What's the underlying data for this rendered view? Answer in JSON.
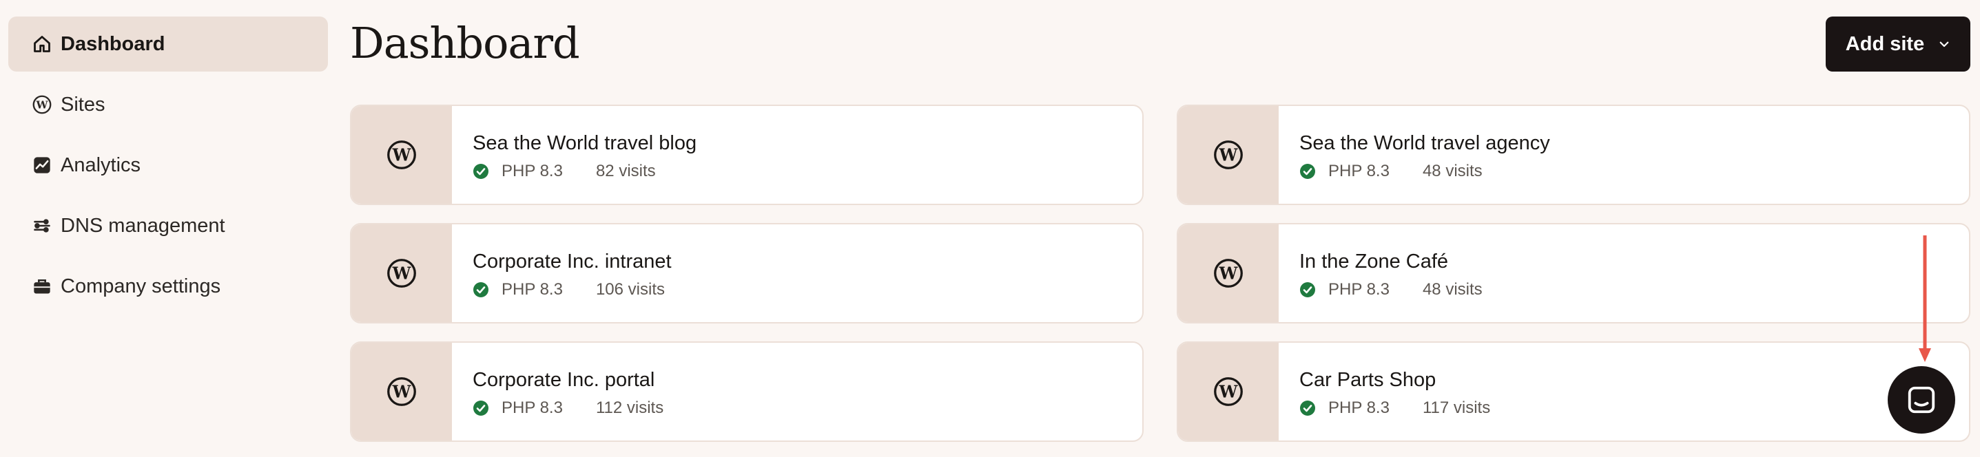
{
  "sidebar": {
    "items": [
      {
        "label": "Dashboard",
        "icon": "home-icon",
        "active": true
      },
      {
        "label": "Sites",
        "icon": "wordpress-icon"
      },
      {
        "label": "Analytics",
        "icon": "analytics-icon"
      },
      {
        "label": "DNS management",
        "icon": "dns-icon"
      },
      {
        "label": "Company settings",
        "icon": "briefcase-icon"
      }
    ]
  },
  "header": {
    "title": "Dashboard",
    "add_site_label": "Add site"
  },
  "sites": [
    {
      "name": "Sea the World travel blog",
      "php": "PHP 8.3",
      "visits": "82 visits"
    },
    {
      "name": "Sea the World travel agency",
      "php": "PHP 8.3",
      "visits": "48 visits"
    },
    {
      "name": "Corporate Inc. intranet",
      "php": "PHP 8.3",
      "visits": "106 visits"
    },
    {
      "name": "In the Zone Café",
      "php": "PHP 8.3",
      "visits": "48 visits"
    },
    {
      "name": "Corporate Inc. portal",
      "php": "PHP 8.3",
      "visits": "112 visits"
    },
    {
      "name": "Car Parts Shop",
      "php": "PHP 8.3",
      "visits": "117 visits"
    }
  ],
  "colors": {
    "background": "#fbf6f3",
    "accent_bg": "#ecdfd7",
    "thumb_bg": "#ebdcd3",
    "button_dark": "#1a1414",
    "status_green": "#1f7a3f",
    "annotation_red": "#e8574a"
  }
}
